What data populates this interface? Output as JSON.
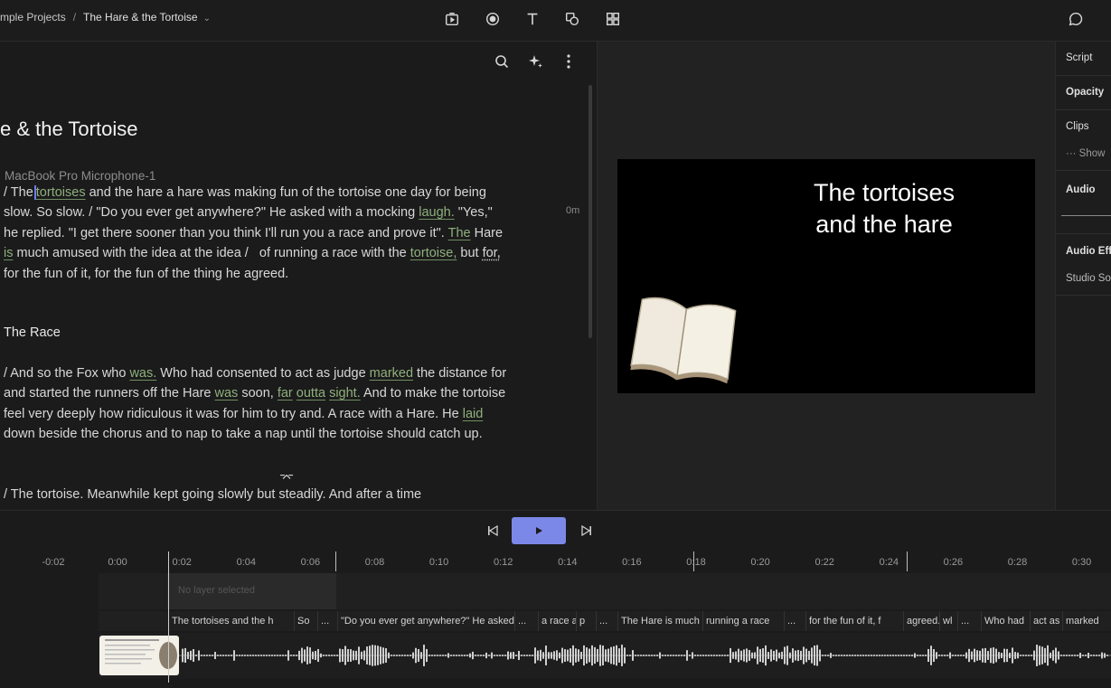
{
  "breadcrumb": {
    "parent": "mple Projects",
    "separator": "/",
    "current": "The Hare & the Tortoise"
  },
  "editor": {
    "title": "e & the Tortoise",
    "speaker": "MacBook Pro Microphone-1",
    "zero_label": "0m",
    "section_heading": "The Race"
  },
  "preview": {
    "slide_title_line1": "The tortoises",
    "slide_title_line2": "and the hare"
  },
  "properties": {
    "script": "Script",
    "opacity": "Opacity",
    "clips": "Clips",
    "clips_more": "···  Show",
    "audio": "Audio",
    "audio_effects": "Audio Effe",
    "studio_sound": "Studio So"
  },
  "timeline": {
    "ticks": [
      "-0:02",
      "0:00",
      "0:02",
      "0:04",
      "0:06",
      "0:08",
      "0:10",
      "0:12",
      "0:14",
      "0:16",
      "0:18",
      "0:20",
      "0:22",
      "0:24",
      "0:26",
      "0:28",
      "0:30"
    ],
    "no_layer": "No layer selected",
    "segments": [
      "The tortoises and the h",
      "...",
      "So",
      "...",
      "\"Do you ever get anywhere?\" He asked v",
      "...",
      "a race a",
      "p",
      "...",
      "The Hare is much",
      "running a race",
      "...",
      "for the fun of it, f",
      "agreed. A",
      "wl",
      "...",
      "Who had",
      "act as",
      "marked"
    ]
  },
  "icons": {
    "toolbar": [
      "present-icon",
      "record-icon",
      "text-icon",
      "shapes-icon",
      "grid-icon",
      "comment-icon"
    ],
    "editor": [
      "search-icon",
      "sparkle-icon",
      "more-vertical-icon"
    ],
    "transport": [
      "skip-back-icon",
      "play-icon",
      "skip-forward-icon"
    ]
  },
  "colors": {
    "accent_play": "#7b88e8",
    "highlight_word": "#8fb07d",
    "background": "#1b1b1b"
  }
}
